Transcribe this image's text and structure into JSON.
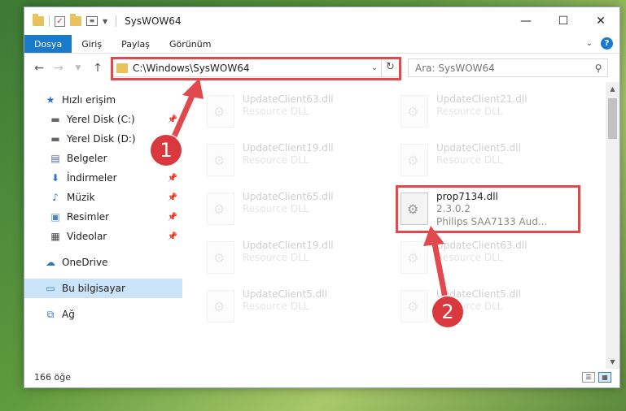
{
  "window": {
    "title": "SysWOW64",
    "controls": {
      "minimize": "—",
      "maximize": "☐",
      "close": "✕"
    }
  },
  "ribbon": {
    "tabs": [
      {
        "label": "Dosya"
      },
      {
        "label": "Giriş"
      },
      {
        "label": "Paylaş"
      },
      {
        "label": "Görünüm"
      }
    ],
    "help": "?"
  },
  "nav": {
    "address": "C:\\Windows\\SysWOW64",
    "search_placeholder": "Ara: SysWOW64"
  },
  "sidebar": {
    "items": [
      {
        "label": "Hızlı erişim",
        "icon": "star-icon"
      },
      {
        "label": "Yerel Disk (C:)",
        "icon": "drive-icon"
      },
      {
        "label": "Yerel Disk (D:)",
        "icon": "drive-icon"
      },
      {
        "label": "Belgeler",
        "icon": "documents-icon"
      },
      {
        "label": "İndirmeler",
        "icon": "download-icon"
      },
      {
        "label": "Müzik",
        "icon": "music-icon"
      },
      {
        "label": "Resimler",
        "icon": "pictures-icon"
      },
      {
        "label": "Videolar",
        "icon": "video-icon"
      },
      {
        "label": "OneDrive",
        "icon": "cloud-icon"
      },
      {
        "label": "Bu bilgisayar",
        "icon": "computer-icon"
      },
      {
        "label": "Ağ",
        "icon": "network-icon"
      }
    ]
  },
  "files": [
    {
      "name": "UpdateClient63.dll",
      "desc": "Resource DLL"
    },
    {
      "name": "UpdateClient21.dll",
      "desc": "Resource DLL"
    },
    {
      "name": "UpdateClient19.dll",
      "desc": "Resource DLL"
    },
    {
      "name": "UpdateClient5.dll",
      "desc": "Resource DLL"
    },
    {
      "name": "UpdateClient65.dll",
      "desc": "Resource DLL"
    },
    {
      "name": "prop7134.dll",
      "version": "2.3.0.2",
      "company": "Philips SAA7133 Aud..."
    },
    {
      "name": "UpdateClient19.dll",
      "desc": "Resource DLL"
    },
    {
      "name": "UpdateClient63.dll",
      "desc": "Resource DLL"
    },
    {
      "name": "UpdateClient5.dll",
      "desc": "Resource DLL"
    },
    {
      "name": "UpdateClient5.dll",
      "desc": "Resource DLL"
    }
  ],
  "status": {
    "count": "166 öğe"
  },
  "annotations": {
    "badge1": "1",
    "badge2": "2",
    "color": "#e0494d"
  }
}
